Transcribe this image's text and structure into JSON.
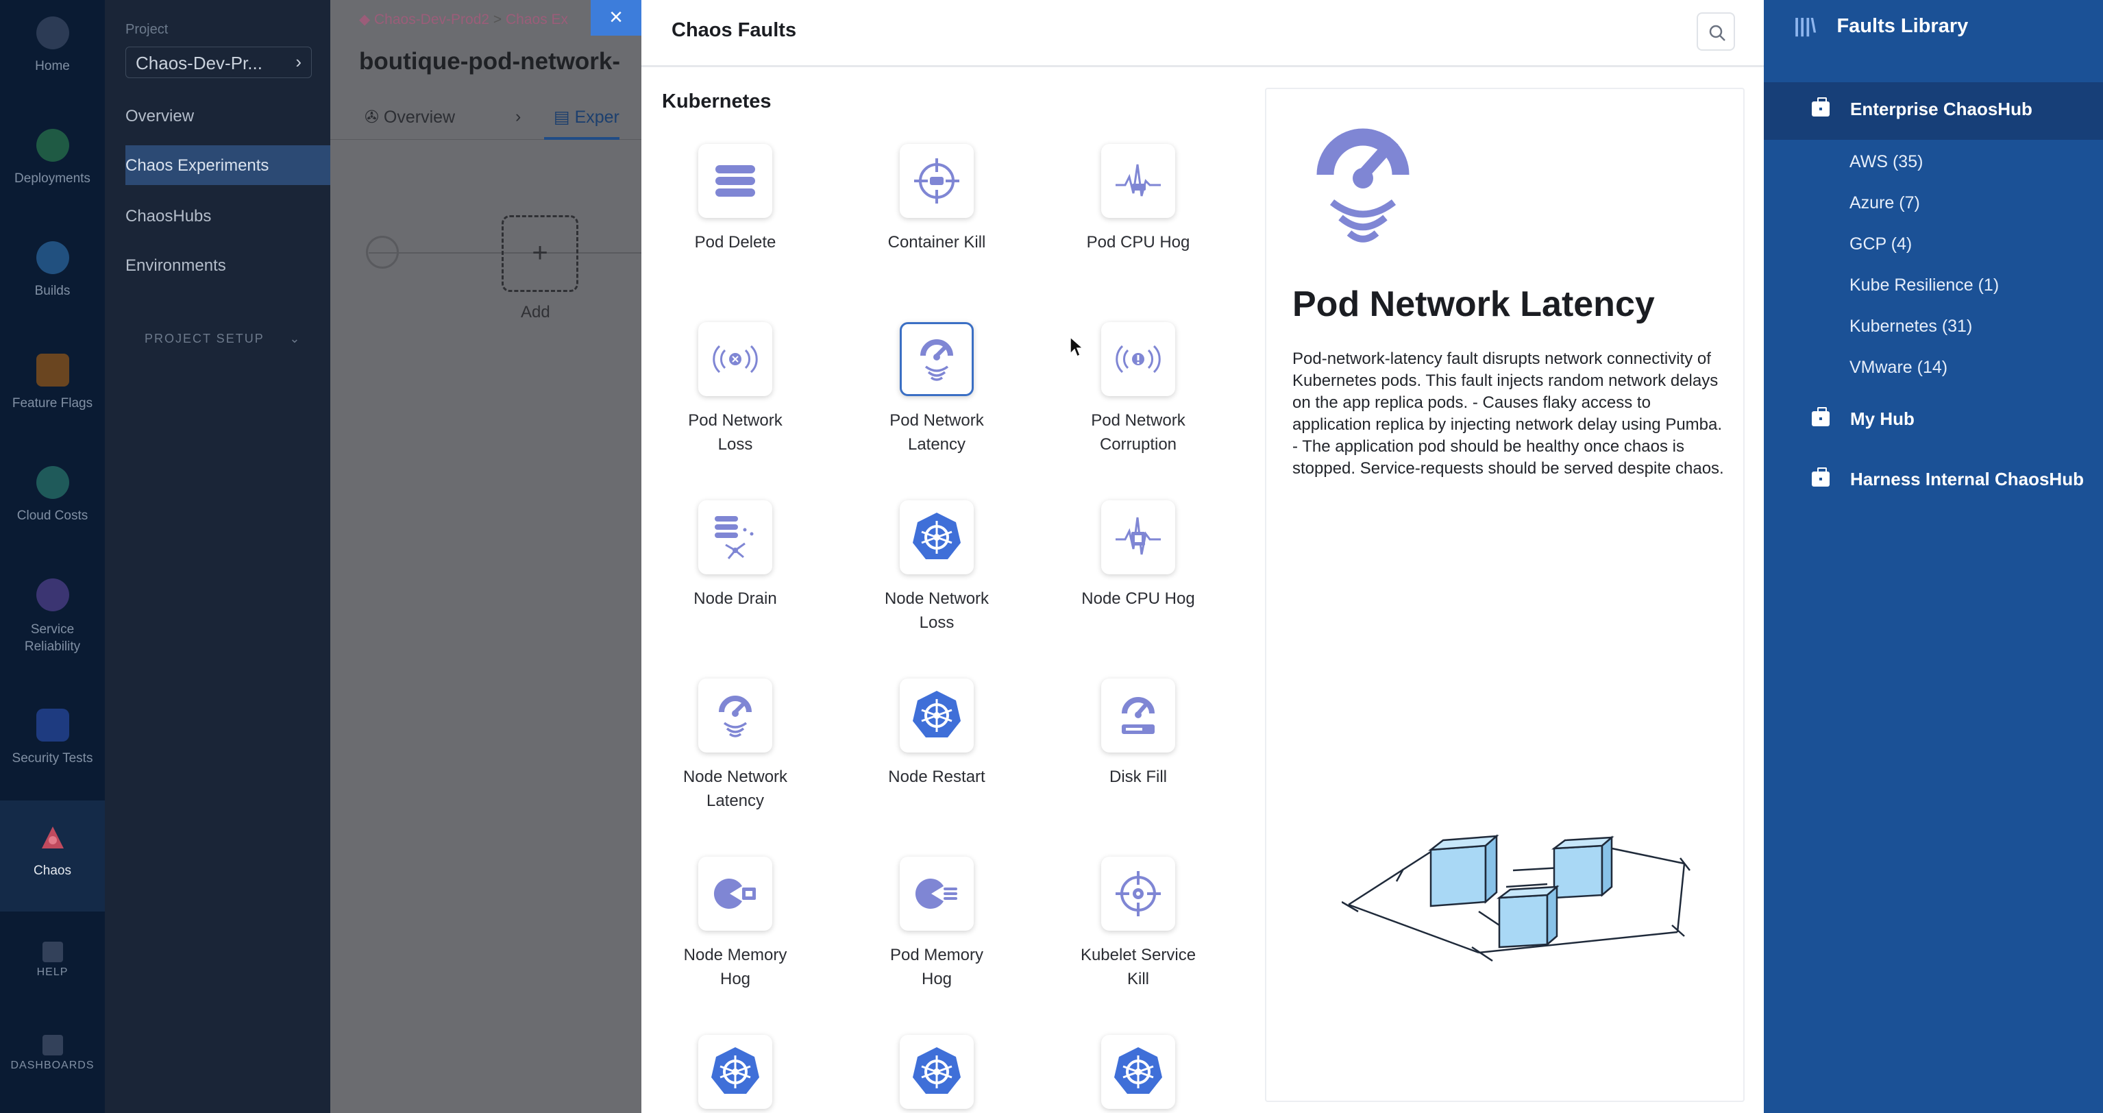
{
  "left_nav": {
    "items": [
      {
        "label": "Home",
        "icon": "home-icon"
      },
      {
        "label": "Deployments",
        "icon": "deployments-icon"
      },
      {
        "label": "Builds",
        "icon": "builds-icon"
      },
      {
        "label": "Feature Flags",
        "icon": "feature-flags-icon"
      },
      {
        "label": "Cloud Costs",
        "icon": "cloud-costs-icon"
      },
      {
        "label": "Service Reliability",
        "icon": "service-reliability-icon"
      },
      {
        "label": "Security Tests",
        "icon": "security-tests-icon"
      },
      {
        "label": "Chaos",
        "icon": "chaos-icon"
      },
      {
        "label": "HELP",
        "icon": "help-icon"
      },
      {
        "label": "DASHBOARDS",
        "icon": "dashboards-icon"
      }
    ]
  },
  "project_nav": {
    "project_label": "Project",
    "project_name": "Chaos-Dev-Pr...",
    "items": [
      "Overview",
      "Chaos Experiments",
      "ChaosHubs",
      "Environments"
    ],
    "setup_label": "PROJECT SETUP"
  },
  "canvas": {
    "breadcrumb_1": "Chaos-Dev-Prod2",
    "breadcrumb_sep": ">",
    "breadcrumb_2": "Chaos Ex",
    "experiment_title": "boutique-pod-network-",
    "tab_overview": "Overview",
    "tab_experiment": "Exper",
    "add_label": "Add",
    "add_symbol": "+"
  },
  "modal": {
    "close_symbol": "×",
    "title": "Chaos Faults",
    "category": "Kubernetes",
    "faults": [
      {
        "label": "Pod Delete",
        "icon": "pod-delete-icon"
      },
      {
        "label": "Container Kill",
        "icon": "container-kill-icon"
      },
      {
        "label": "Pod CPU Hog",
        "icon": "pod-cpu-hog-icon"
      },
      {
        "label": "Pod Network Loss",
        "icon": "pod-network-loss-icon"
      },
      {
        "label": "Pod Network Latency",
        "icon": "pod-network-latency-icon",
        "selected": true
      },
      {
        "label": "Pod Network Corruption",
        "icon": "pod-network-corruption-icon"
      },
      {
        "label": "Node Drain",
        "icon": "node-drain-icon"
      },
      {
        "label": "Node Network Loss",
        "icon": "kubernetes-icon"
      },
      {
        "label": "Node CPU Hog",
        "icon": "node-cpu-hog-icon"
      },
      {
        "label": "Node Network Latency",
        "icon": "node-network-latency-icon"
      },
      {
        "label": "Node Restart",
        "icon": "kubernetes-icon"
      },
      {
        "label": "Disk Fill",
        "icon": "disk-fill-icon"
      },
      {
        "label": "Node Memory Hog",
        "icon": "node-memory-hog-icon"
      },
      {
        "label": "Pod Memory Hog",
        "icon": "pod-memory-hog-icon"
      },
      {
        "label": "Kubelet Service Kill",
        "icon": "kubelet-service-kill-icon"
      }
    ],
    "detail": {
      "title": "Pod Network Latency",
      "description": "Pod-network-latency fault disrupts network connectivity of Kubernetes pods. This fault injects random network delays on the app replica pods. - Causes flaky access to application replica by injecting network delay using Pumba. - The application pod should be healthy once chaos is stopped. Service-requests should be served despite chaos."
    }
  },
  "library": {
    "title": "Faults Library",
    "hubs": [
      {
        "label": "Enterprise ChaosHub",
        "active": true
      },
      {
        "label": "My Hub"
      },
      {
        "label": "Harness Internal ChaosHub"
      }
    ],
    "enterprise_items": [
      "AWS (35)",
      "Azure (7)",
      "GCP (4)",
      "Kube Resilience (1)",
      "Kubernetes (31)",
      "VMware (14)"
    ]
  },
  "colors": {
    "accent": "#3d7ddb",
    "icon_purple": "#7f86d4",
    "library_bg": "#1b5196",
    "library_active": "#173f78"
  }
}
